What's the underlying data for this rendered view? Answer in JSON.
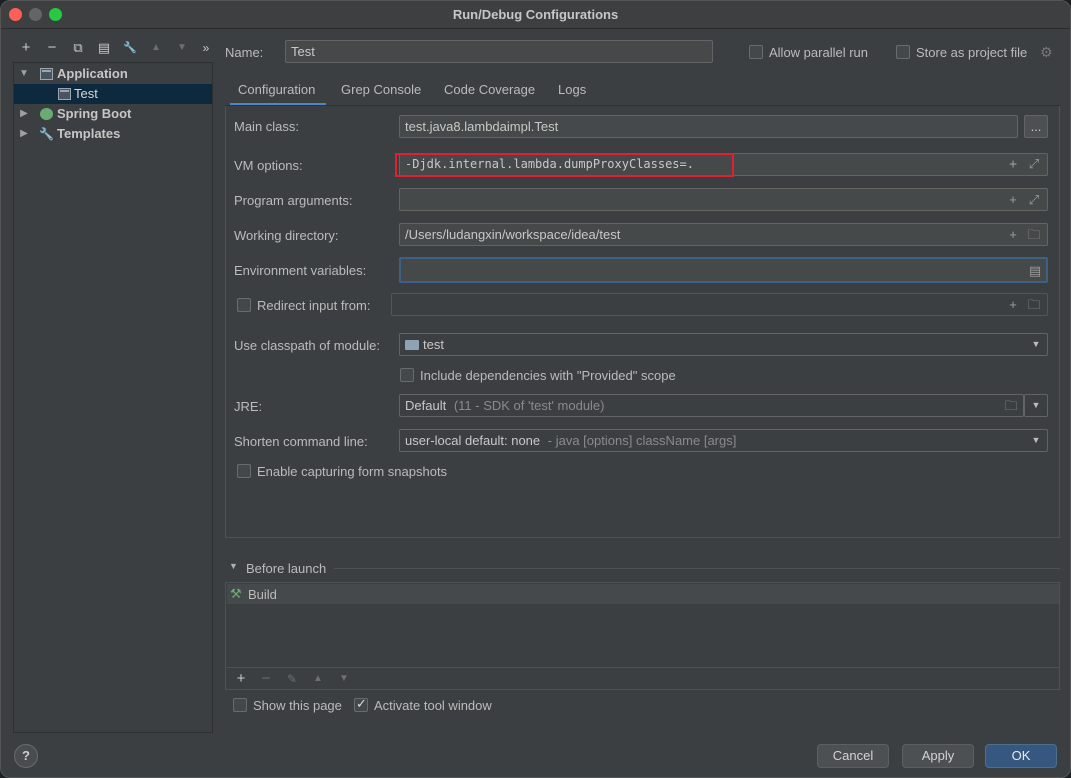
{
  "window": {
    "title": "Run/Debug Configurations"
  },
  "left_toolbar": {
    "add": "+",
    "remove": "−",
    "copy": "⧉",
    "save": "▤",
    "edit": "🔧",
    "up": "▲",
    "down": "▼",
    "more": "»"
  },
  "tree": {
    "items": [
      {
        "label": "Application",
        "expanded": true
      },
      {
        "label": "Test",
        "selected": true
      },
      {
        "label": "Spring Boot",
        "expanded": false
      },
      {
        "label": "Templates",
        "expanded": false
      }
    ]
  },
  "header": {
    "name_label": "Name:",
    "name_value": "Test",
    "allow_parallel_label": "Allow parallel run",
    "store_project_label": "Store as project file"
  },
  "tabs": [
    "Configuration",
    "Grep Console",
    "Code Coverage",
    "Logs"
  ],
  "config": {
    "main_class_label": "Main class:",
    "main_class_value": "test.java8.lambdaimpl.Test",
    "browse_label": "...",
    "vm_options_label": "VM options:",
    "vm_options_value": "-Djdk.internal.lambda.dumpProxyClasses=.",
    "program_args_label": "Program arguments:",
    "program_args_value": "",
    "working_dir_label": "Working directory:",
    "working_dir_value": "/Users/ludangxin/workspace/idea/test",
    "env_vars_label": "Environment variables:",
    "env_vars_value": "",
    "redirect_label": "Redirect input from:",
    "redirect_value": "",
    "classpath_label": "Use classpath of module:",
    "classpath_value": "test",
    "include_deps_label": "Include dependencies with \"Provided\" scope",
    "jre_label": "JRE:",
    "jre_value": "Default",
    "jre_hint": "(11 - SDK of 'test' module)",
    "shorten_label": "Shorten command line:",
    "shorten_value": "user-local default: none",
    "shorten_hint": "- java [options] className [args]",
    "snapshots_label": "Enable capturing form snapshots"
  },
  "before_launch": {
    "title": "Before launch",
    "tasks": [
      "Build"
    ]
  },
  "footer": {
    "show_page_label": "Show this page",
    "activate_tool_label": "Activate tool window",
    "help_label": "?",
    "cancel_label": "Cancel",
    "apply_label": "Apply",
    "ok_label": "OK"
  }
}
